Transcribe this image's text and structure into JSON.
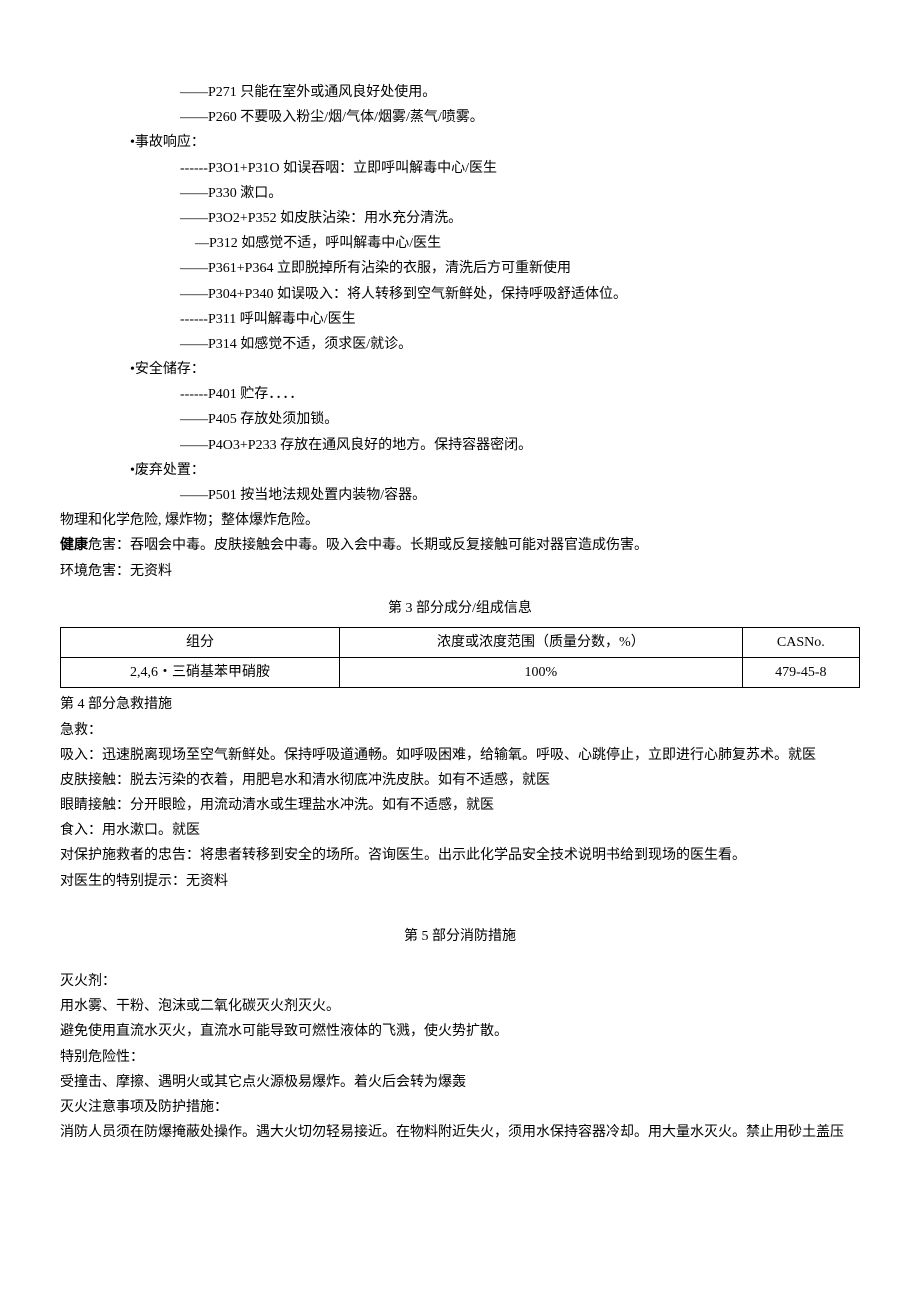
{
  "lines": {
    "l1": "——P271 只能在室外或通风良好处使用。",
    "l2": "——P260 不要吸入粉尘/烟/气体/烟雾/蒸气/喷雾。",
    "l3": "•事故响应：",
    "l4": "------P3O1+P31O 如误吞咽：立即呼叫解毒中心/医生",
    "l5": "——P330 漱口。",
    "l6": "——P3O2+P352 如皮肤沾染：用水充分清洗。",
    "l7": "—P312 如感觉不适，呼叫解毒中心/医生",
    "l8": "——P361+P364 立即脱掉所有沾染的衣服，清洗后方可重新使用",
    "l9": "——P304+P340 如误吸入：将人转移到空气新鲜处，保持呼吸舒适体位。",
    "l10": "------P311 呼叫解毒中心/医生",
    "l11": "——P314 如感觉不适，须求医/就诊。",
    "l12": "•安全储存：",
    "l13": "------P401 贮存．．．．",
    "l14": "——P405 存放处须加锁。",
    "l15": "——P4O3+P233 存放在通风良好的地方。保持容器密闭。",
    "l16": "•废弃处置：",
    "l17": "——P501 按当地法规处置内装物/容器。",
    "l18": "物理和化学危险, 爆炸物；整体爆炸危险。",
    "l19a": "健康",
    "l19b": "危害：吞咽会中毒。皮肤接触会中毒。吸入会中毒。长期或反复接触可能对器官造成伤害。",
    "l20": "环境危害：无资料"
  },
  "section3": {
    "title": "第 3 部分成分/组成信息",
    "headers": {
      "c1": "组分",
      "c2": "浓度或浓度范围（质量分数，%）",
      "c3": "CASNo."
    },
    "row": {
      "c1": "2,4,6・三硝基苯甲硝胺",
      "c2": "100%",
      "c3": "479-45-8"
    }
  },
  "section4": {
    "title": "第 4 部分急救措施",
    "p1": "急救：",
    "p2": "吸入：迅速脱离现场至空气新鲜处。保持呼吸道通畅。如呼吸困难，给输氧。呼吸、心跳停止，立即进行心肺复苏术。就医",
    "p3": "皮肤接触：脱去污染的衣着，用肥皂水和清水彻底冲洗皮肤。如有不适感，就医",
    "p4": "眼睛接触：分开眼睑，用流动清水或生理盐水冲洗。如有不适感，就医",
    "p5": "食入：用水漱口。就医",
    "p6": "对保护施救者的忠告：将患者转移到安全的场所。咨询医生。出示此化学品安全技术说明书给到现场的医生看。",
    "p7": "对医生的特别提示：无资料"
  },
  "section5": {
    "title": "第 5 部分消防措施",
    "p1": "灭火剂：",
    "p2": "用水雾、干粉、泡沫或二氧化碳灭火剂灭火。",
    "p3": "避免使用直流水灭火，直流水可能导致可燃性液体的飞溅，使火势扩散。",
    "p4": "特别危险性：",
    "p5": "受撞击、摩擦、遇明火或其它点火源极易爆炸。着火后会转为爆轰",
    "p6": "灭火注意事项及防护措施：",
    "p7": "消防人员须在防爆掩蔽处操作。遇大火切勿轻易接近。在物料附近失火，须用水保持容器冷却。用大量水灭火。禁止用砂土盖压"
  }
}
